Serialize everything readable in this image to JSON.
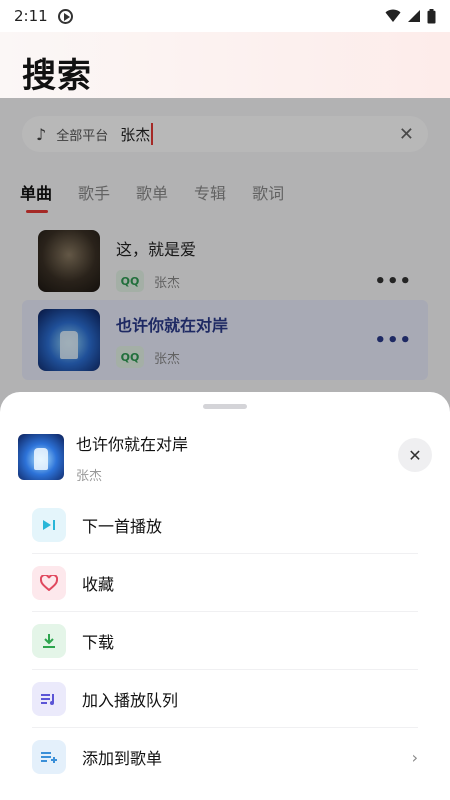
{
  "status_bar": {
    "time": "2:11"
  },
  "header": {
    "title": "搜索"
  },
  "search": {
    "platform": "全部平台",
    "query": "张杰"
  },
  "tabs": [
    {
      "label": "单曲",
      "active": true
    },
    {
      "label": "歌手"
    },
    {
      "label": "歌单"
    },
    {
      "label": "专辑"
    },
    {
      "label": "歌词"
    }
  ],
  "results": [
    {
      "title": "这，就是爱",
      "source": "QQ",
      "artist": "张杰"
    },
    {
      "title": "也许你就在对岸",
      "source": "QQ",
      "artist": "张杰"
    }
  ],
  "sheet": {
    "song_title": "也许你就在对岸",
    "song_artist": "张杰",
    "menu": [
      {
        "label": "下一首播放",
        "icon": "play-next-icon",
        "icon_color": "#29b6d8",
        "bg": "#e4f5fb"
      },
      {
        "label": "收藏",
        "icon": "heart-icon",
        "icon_color": "#e0485e",
        "bg": "#fde8ec"
      },
      {
        "label": "下载",
        "icon": "download-icon",
        "icon_color": "#2ea54f",
        "bg": "#e4f5e8"
      },
      {
        "label": "加入播放队列",
        "icon": "queue-icon",
        "icon_color": "#5b55d6",
        "bg": "#ebeafb"
      },
      {
        "label": "添加到歌单",
        "icon": "add-playlist-icon",
        "icon_color": "#3a8fd8",
        "bg": "#e4f0fb"
      }
    ]
  }
}
